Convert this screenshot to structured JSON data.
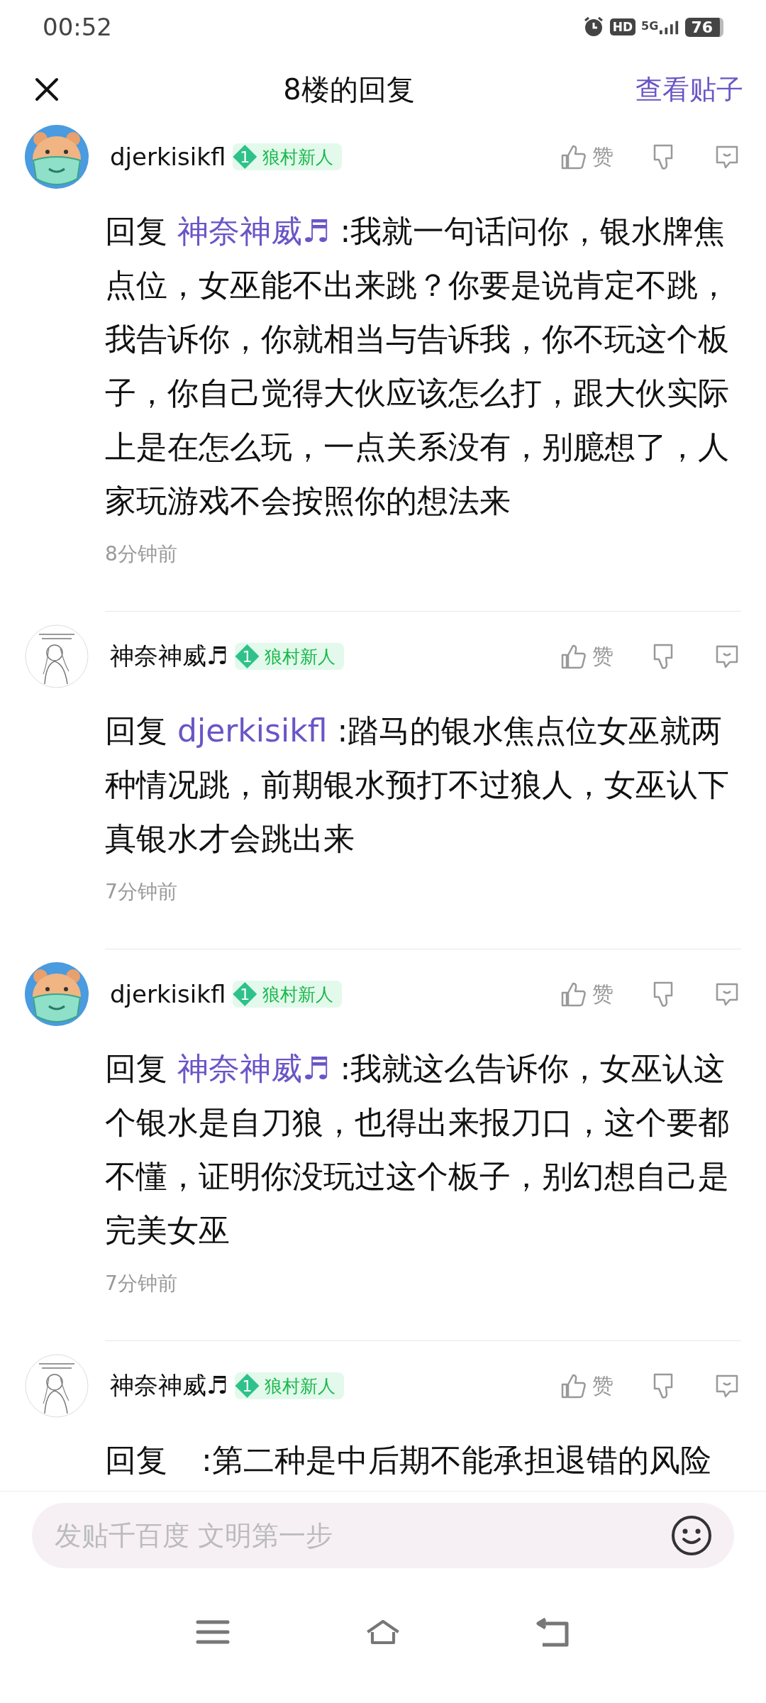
{
  "status_bar": {
    "time": "00:52",
    "hd": "HD",
    "network": "5G",
    "battery": "76"
  },
  "header": {
    "title": "8楼的回复",
    "action": "查看贴子"
  },
  "comments": [
    {
      "avatar": {
        "kind": "bear"
      },
      "user": "djerkisikfl",
      "badge_level": "1",
      "badge": "狼村新人",
      "reply_prefix": "回复",
      "reply_to": "神奈神威♬",
      "body": ":我就一句话问你，银水牌焦点位，女巫能不出来跳？你要是说肯定不跳，我告诉你，你就相当与告诉我，你不玩这个板子，你自己觉得大伙应该怎么打，跟大伙实际上是在怎么玩，一点关系没有，别臆想了，人家玩游戏不会按照你的想法来",
      "time": "8分钟前",
      "like": "赞"
    },
    {
      "avatar": {
        "kind": "sketch"
      },
      "user": "神奈神威♬",
      "badge_level": "1",
      "badge": "狼村新人",
      "reply_prefix": "回复",
      "reply_to": "djerkisikfl",
      "body": ":踏马的银水焦点位女巫就两种情况跳，前期银水预打不过狼人，女巫认下真银水才会跳出来",
      "time": "7分钟前",
      "like": "赞"
    },
    {
      "avatar": {
        "kind": "bear"
      },
      "user": "djerkisikfl",
      "badge_level": "1",
      "badge": "狼村新人",
      "reply_prefix": "回复",
      "reply_to": "神奈神威♬",
      "body": ":我就这么告诉你，女巫认这个银水是自刀狼，也得出来报刀口，这个要都不懂，证明你没玩过这个板子，别幻想自己是完美女巫",
      "time": "7分钟前",
      "like": "赞"
    },
    {
      "avatar": {
        "kind": "sketch"
      },
      "user": "神奈神威♬",
      "badge_level": "1",
      "badge": "狼村新人",
      "reply_prefix": "回复",
      "body": ":第二种是中后期不能承担退错的风险",
      "like": "赞"
    }
  ],
  "composer": {
    "placeholder": "发贴千百度 文明第一步"
  }
}
